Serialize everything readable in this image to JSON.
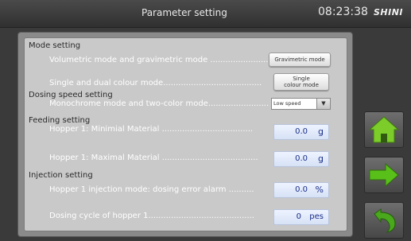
{
  "header": {
    "title": "Parameter setting",
    "time": "08:23:38",
    "brand": "SHINI"
  },
  "sections": {
    "mode": "Mode setting",
    "dosing_speed": "Dosing speed setting",
    "feeding": "Feeding setting",
    "injection": "Injection setting"
  },
  "rows": {
    "volumetric": {
      "label": "Volumetric mode and gravimetric mode",
      "dots": " ........................",
      "button": "Gravimetric mode"
    },
    "colour": {
      "label": "Single and dual colour mode",
      "dots": ".......................................",
      "button": "Single colour mode"
    },
    "monochrome": {
      "label": "Monochrome mode and two-color mode",
      "dots": "........................",
      "select": "Low speed"
    },
    "min_material": {
      "label": "Hopper 1: Minimial Material",
      "dots": " ....................................",
      "value": "0.0",
      "unit": "g"
    },
    "max_material": {
      "label": "Hopper 1: Maximal Material",
      "dots": " ......................................",
      "value": "0.0",
      "unit": "g"
    },
    "injection_mode": {
      "label": "Hopper 1 injection mode: dosing error alarm",
      "dots": " ..........",
      "value": "0.0",
      "unit": "%"
    },
    "dosing_cycle": {
      "label": "Dosing cycle of hopper 1",
      "dots": "..........................................",
      "value": "0",
      "unit": "pes"
    }
  },
  "nav": {
    "home_icon": "home-icon",
    "next_icon": "arrow-right-icon",
    "back_icon": "return-icon",
    "colors": {
      "home": "#7ccc2a",
      "next": "#59c01a",
      "back": "#4aa81c"
    }
  }
}
